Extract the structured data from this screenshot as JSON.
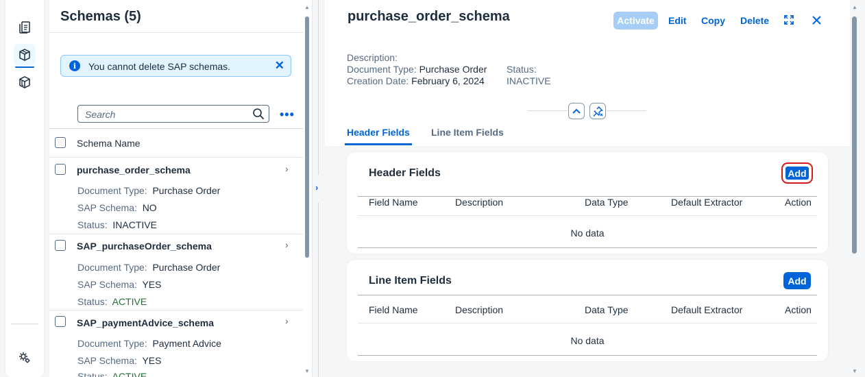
{
  "colors": {
    "brand": "#0064d9",
    "positive": "#256f3a",
    "focus_outline": "#d61a1a"
  },
  "nav": {
    "items": [
      {
        "name": "documents-icon",
        "active": false
      },
      {
        "name": "schema-icon",
        "active": true
      },
      {
        "name": "templates-icon",
        "active": false
      }
    ],
    "bottom": {
      "name": "settings-icon"
    }
  },
  "master": {
    "title": "Schemas (5)",
    "message": "You cannot delete SAP schemas.",
    "search_placeholder": "Search",
    "column_header": "Schema Name",
    "items": [
      {
        "title": "purchase_order_schema",
        "doc_type_label": "Document Type:",
        "doc_type": "Purchase Order",
        "sap_label": "SAP Schema:",
        "sap": "NO",
        "status_label": "Status:",
        "status": "INACTIVE"
      },
      {
        "title": "SAP_purchaseOrder_schema",
        "doc_type_label": "Document Type:",
        "doc_type": "Purchase Order",
        "sap_label": "SAP Schema:",
        "sap": "YES",
        "status_label": "Status:",
        "status": "ACTIVE"
      },
      {
        "title": "SAP_paymentAdvice_schema",
        "doc_type_label": "Document Type:",
        "doc_type": "Payment Advice",
        "sap_label": "SAP Schema:",
        "sap": "YES",
        "status_label": "Status:",
        "status": "ACTIVE"
      }
    ]
  },
  "detail": {
    "title": "purchase_order_schema",
    "actions": {
      "activate": "Activate",
      "edit": "Edit",
      "copy": "Copy",
      "delete": "Delete"
    },
    "description_label": "Description:",
    "doc_type_label": "Document Type:",
    "doc_type": "Purchase Order",
    "creation_label": "Creation Date:",
    "creation_date": "February 6, 2024",
    "status_label": "Status:",
    "status": "INACTIVE",
    "tabs": [
      "Header Fields",
      "Line Item Fields"
    ],
    "sections": [
      {
        "title": "Header Fields",
        "add": "Add",
        "columns": [
          "Field Name",
          "Description",
          "Data Type",
          "Default Extractor",
          "Action"
        ],
        "empty": "No data"
      },
      {
        "title": "Line Item Fields",
        "add": "Add",
        "columns": [
          "Field Name",
          "Description",
          "Data Type",
          "Default Extractor",
          "Action"
        ],
        "empty": "No data"
      }
    ]
  }
}
